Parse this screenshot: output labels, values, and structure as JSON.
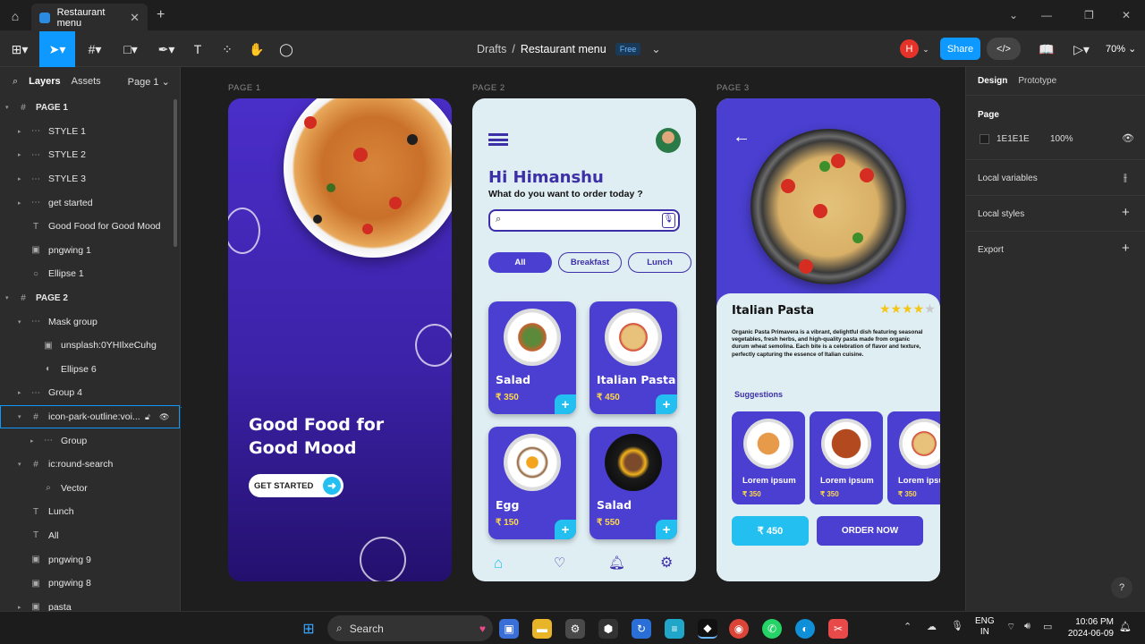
{
  "browser": {
    "tab_title": "Restaurant menu"
  },
  "toolbar": {
    "breadcrumb_parent": "Drafts",
    "breadcrumb_sep": "/",
    "file_name": "Restaurant menu",
    "plan_badge": "Free",
    "user_initial": "H",
    "share_label": "Share",
    "zoom": "70%"
  },
  "left_panel": {
    "tabs": {
      "layers": "Layers",
      "assets": "Assets",
      "page": "Page 1"
    },
    "layers": [
      {
        "name": "PAGE 1",
        "type": "page",
        "depth": 0,
        "icon": "#",
        "caret": "▾"
      },
      {
        "name": "STYLE 1",
        "type": "frame",
        "depth": 1,
        "icon": "⋯",
        "caret": "▸"
      },
      {
        "name": "STYLE 2",
        "type": "frame",
        "depth": 1,
        "icon": "⋯",
        "caret": "▸"
      },
      {
        "name": "STYLE 3",
        "type": "frame",
        "depth": 1,
        "icon": "⋯",
        "caret": "▸"
      },
      {
        "name": "get started",
        "type": "frame",
        "depth": 1,
        "icon": "⋯",
        "caret": "▸"
      },
      {
        "name": "Good Food for Good Mood",
        "type": "text",
        "depth": 1,
        "icon": "T",
        "caret": ""
      },
      {
        "name": "pngwing 1",
        "type": "image",
        "depth": 1,
        "icon": "▣",
        "caret": ""
      },
      {
        "name": "Ellipse 1",
        "type": "ellipse",
        "depth": 1,
        "icon": "○",
        "caret": ""
      },
      {
        "name": "PAGE 2",
        "type": "page",
        "depth": 0,
        "icon": "#",
        "caret": "▾"
      },
      {
        "name": "Mask group",
        "type": "group",
        "depth": 1,
        "icon": "⋯",
        "caret": "▾"
      },
      {
        "name": "unsplash:0YHIlxeCuhg",
        "type": "image",
        "depth": 2,
        "icon": "▣",
        "caret": ""
      },
      {
        "name": "Ellipse 6",
        "type": "ellipse",
        "depth": 2,
        "icon": "◐",
        "caret": ""
      },
      {
        "name": "Group 4",
        "type": "group",
        "depth": 1,
        "icon": "⋯",
        "caret": "▸"
      },
      {
        "name": "icon-park-outline:voi...",
        "type": "frame",
        "depth": 1,
        "icon": "#",
        "caret": "▾",
        "selected": true
      },
      {
        "name": "Group",
        "type": "group",
        "depth": 2,
        "icon": "⋯",
        "caret": "▸"
      },
      {
        "name": "ic:round-search",
        "type": "frame",
        "depth": 1,
        "icon": "#",
        "caret": "▾"
      },
      {
        "name": "Vector",
        "type": "vector",
        "depth": 2,
        "icon": "⌕",
        "caret": ""
      },
      {
        "name": "Lunch",
        "type": "text",
        "depth": 1,
        "icon": "T",
        "caret": ""
      },
      {
        "name": "All",
        "type": "text",
        "depth": 1,
        "icon": "T",
        "caret": ""
      },
      {
        "name": "pngwing 9",
        "type": "image",
        "depth": 1,
        "icon": "▣",
        "caret": ""
      },
      {
        "name": "pngwing 8",
        "type": "image",
        "depth": 1,
        "icon": "▣",
        "caret": ""
      },
      {
        "name": "pasta",
        "type": "image",
        "depth": 1,
        "icon": "▣",
        "caret": "▸"
      }
    ]
  },
  "canvas": {
    "page_labels": [
      "PAGE 1",
      "PAGE 2",
      "PAGE 3"
    ],
    "page1": {
      "headline_line1": "Good Food for",
      "headline_line2": "Good Mood",
      "cta": "GET STARTED"
    },
    "page2": {
      "greeting": "Hi Himanshu",
      "subtitle": "What do you want to order today ?",
      "chips": [
        "All",
        "Breakfast",
        "Lunch"
      ],
      "items": [
        {
          "name": "Salad",
          "price": "₹ 350"
        },
        {
          "name": "Italian Pasta",
          "price": "₹ 450"
        },
        {
          "name": "Egg",
          "price": "₹ 150"
        },
        {
          "name": "Salad",
          "price": "₹ 550"
        }
      ],
      "add_glyph": "+"
    },
    "page3": {
      "title": "Italian Pasta",
      "description": "Organic Pasta Primavera is a vibrant, delightful dish featuring seasonal vegetables, fresh herbs, and high-quality pasta made from organic durum wheat semolina. Each bite is a celebration of flavor and texture, perfectly capturing the essence of Italian cuisine.",
      "suggestions_label": "Suggestions",
      "suggestions": [
        {
          "name": "Lorem ipsum",
          "price": "₹ 350"
        },
        {
          "name": "Lorem ipsum",
          "price": "₹ 350"
        },
        {
          "name": "Lorem ipsum",
          "price": "₹ 350"
        }
      ],
      "price_button": "₹ 450",
      "order_button": "ORDER NOW",
      "rating": 4
    }
  },
  "right_panel": {
    "tabs": {
      "design": "Design",
      "prototype": "Prototype"
    },
    "page_section": "Page",
    "page_color": "1E1E1E",
    "page_opacity": "100%",
    "local_variables": "Local variables",
    "local_styles": "Local styles",
    "export": "Export",
    "help": "?"
  },
  "taskbar": {
    "search_label": "Search",
    "lang_line1": "ENG",
    "lang_line2": "IN",
    "time": "10:06 PM",
    "date": "2024-06-09"
  },
  "colors": {
    "accent": "#0d99ff",
    "brand_purple": "#4a3fd0",
    "cyan": "#22bff0"
  }
}
